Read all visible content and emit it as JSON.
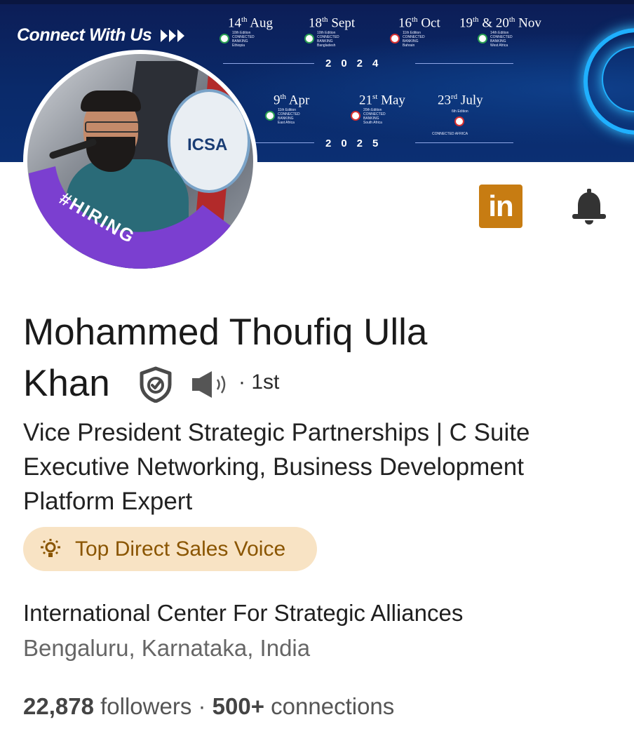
{
  "banner": {
    "title": "Connect  With Us",
    "events_2024": [
      {
        "day": "14",
        "suffix": "th",
        "month": "Aug",
        "line1": "10th Edition",
        "line2": "CONNECTED",
        "line3": "BANKING",
        "line4": "Ethiopia"
      },
      {
        "day": "18",
        "suffix": "th",
        "month": "Sept",
        "line1": "10th Edition",
        "line2": "CONNECTED",
        "line3": "BANKING",
        "line4": "Bangladesh"
      },
      {
        "day": "16",
        "suffix": "th",
        "month": "Oct",
        "line1": "11th Edition",
        "line2": "CONNECTED",
        "line3": "BANKING",
        "line4": "Bahrain"
      },
      {
        "day": "19",
        "suffix": "th",
        "mid": " & 20",
        "suffix2": "th",
        "month": "Nov",
        "line1": "14th Edition",
        "line2": "CONNECTED",
        "line3": "BANKING",
        "line4": "West Africa"
      }
    ],
    "year_2024": "2024",
    "events_2025": [
      {
        "day": "9",
        "suffix": "th",
        "month": "Apr",
        "line1": "11th Edition",
        "line2": "CONNECTED",
        "line3": "BANKING",
        "line4": "East Africa"
      },
      {
        "day": "21",
        "suffix": "st",
        "month": "May",
        "line1": "20th Edition",
        "line2": "CONNECTED",
        "line3": "BANKING",
        "line4": "South Africa"
      },
      {
        "day": "23",
        "suffix": "rd",
        "month": "July",
        "line1": "6th Edition",
        "line2": "CONNECTED AFRICA"
      }
    ],
    "year_2025": "2025"
  },
  "avatar": {
    "badge_text": "#HIRING",
    "photo_sign": "ICSA"
  },
  "actions": {
    "linkedin_label": "in",
    "bell_icon": "bell-icon"
  },
  "profile": {
    "name_line1": "Mohammed Thoufiq Ulla",
    "name_line2": "Khan",
    "degree": "· 1st",
    "headline": "Vice President Strategic Partnerships | C Suite Executive Networking, Business Development Platform Expert",
    "voice_badge": "Top Direct Sales Voice",
    "company": "International Center For Strategic Alliances",
    "location": "Bengaluru, Karnataka, India",
    "followers_count": "22,878",
    "followers_label": " followers · ",
    "connections_count": "500+",
    "connections_label": " connections"
  },
  "colors": {
    "banner_bg": "#0b2a6a",
    "linkedin_orange": "#c77c12",
    "voice_pill_bg": "#f8e3c4",
    "voice_text": "#8a5500",
    "hiring_purple": "#7b3fd0"
  }
}
